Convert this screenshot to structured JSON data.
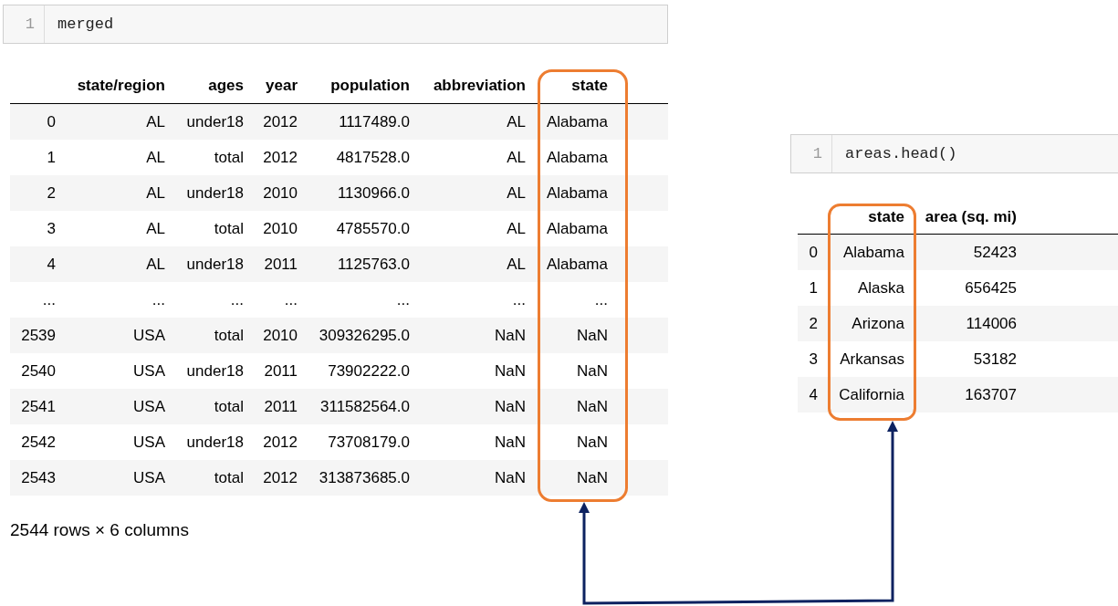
{
  "cells": [
    {
      "line_number": "1",
      "code": "merged",
      "table": {
        "columns": [
          "state/region",
          "ages",
          "year",
          "population",
          "abbreviation",
          "state"
        ],
        "rows": [
          {
            "index": "0",
            "cells": [
              "AL",
              "under18",
              "2012",
              "1117489.0",
              "AL",
              "Alabama"
            ]
          },
          {
            "index": "1",
            "cells": [
              "AL",
              "total",
              "2012",
              "4817528.0",
              "AL",
              "Alabama"
            ]
          },
          {
            "index": "2",
            "cells": [
              "AL",
              "under18",
              "2010",
              "1130966.0",
              "AL",
              "Alabama"
            ]
          },
          {
            "index": "3",
            "cells": [
              "AL",
              "total",
              "2010",
              "4785570.0",
              "AL",
              "Alabama"
            ]
          },
          {
            "index": "4",
            "cells": [
              "AL",
              "under18",
              "2011",
              "1125763.0",
              "AL",
              "Alabama"
            ]
          },
          {
            "index": "...",
            "cells": [
              "...",
              "...",
              "...",
              "...",
              "...",
              "..."
            ]
          },
          {
            "index": "2539",
            "cells": [
              "USA",
              "total",
              "2010",
              "309326295.0",
              "NaN",
              "NaN"
            ]
          },
          {
            "index": "2540",
            "cells": [
              "USA",
              "under18",
              "2011",
              "73902222.0",
              "NaN",
              "NaN"
            ]
          },
          {
            "index": "2541",
            "cells": [
              "USA",
              "total",
              "2011",
              "311582564.0",
              "NaN",
              "NaN"
            ]
          },
          {
            "index": "2542",
            "cells": [
              "USA",
              "under18",
              "2012",
              "73708179.0",
              "NaN",
              "NaN"
            ]
          },
          {
            "index": "2543",
            "cells": [
              "USA",
              "total",
              "2012",
              "313873685.0",
              "NaN",
              "NaN"
            ]
          }
        ]
      },
      "shape_note": "2544 rows × 6 columns"
    },
    {
      "line_number": "1",
      "code": "areas.head()",
      "table": {
        "columns": [
          "state",
          "area (sq. mi)"
        ],
        "rows": [
          {
            "index": "0",
            "cells": [
              "Alabama",
              "52423"
            ]
          },
          {
            "index": "1",
            "cells": [
              "Alaska",
              "656425"
            ]
          },
          {
            "index": "2",
            "cells": [
              "Arizona",
              "114006"
            ]
          },
          {
            "index": "3",
            "cells": [
              "Arkansas",
              "53182"
            ]
          },
          {
            "index": "4",
            "cells": [
              "California",
              "163707"
            ]
          }
        ]
      }
    }
  ]
}
